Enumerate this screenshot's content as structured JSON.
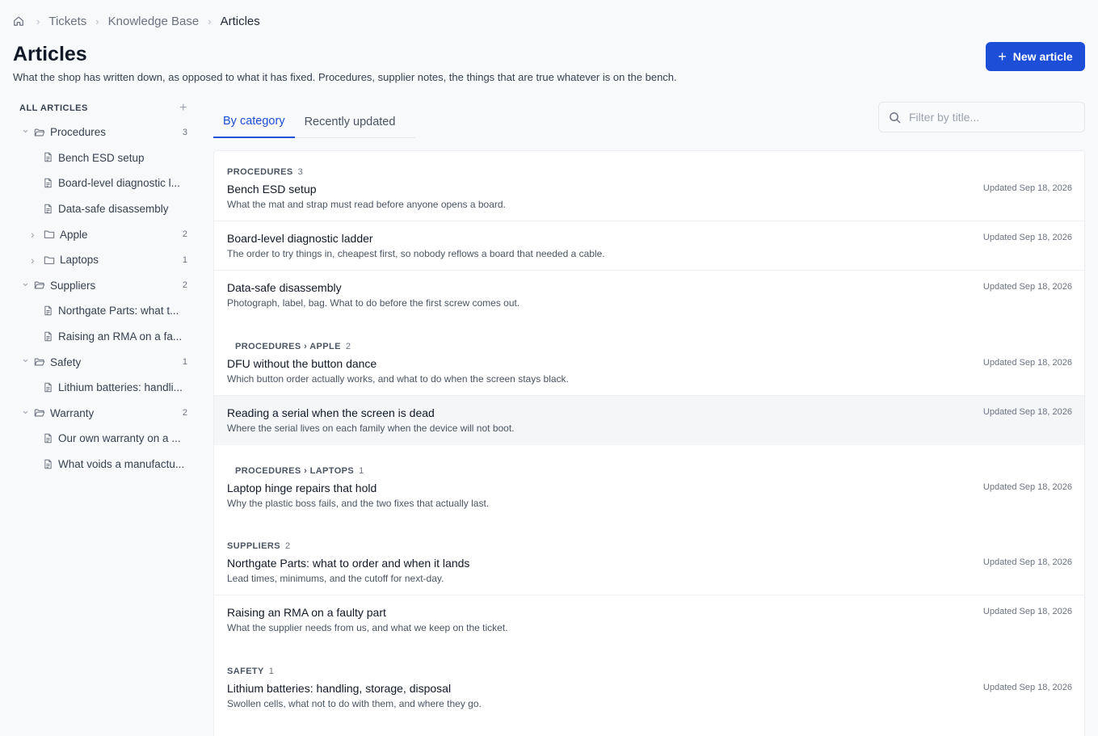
{
  "breadcrumb": {
    "items": [
      "Tickets",
      "Knowledge Base",
      "Articles"
    ]
  },
  "page": {
    "title": "Articles",
    "subtitle": "What the shop has written down, as opposed to what it has fixed. Procedures, supplier notes, the things that are true whatever is on the bench.",
    "new_button": "New article"
  },
  "sidebar": {
    "header": "ALL ARTICLES",
    "tree": [
      {
        "type": "folder",
        "label": "Procedures",
        "count": "3",
        "expanded": true
      },
      {
        "type": "doc",
        "label": "Bench ESD setup"
      },
      {
        "type": "doc",
        "label": "Board-level diagnostic l..."
      },
      {
        "type": "doc",
        "label": "Data-safe disassembly"
      },
      {
        "type": "subfolder",
        "label": "Apple",
        "count": "2"
      },
      {
        "type": "subfolder",
        "label": "Laptops",
        "count": "1"
      },
      {
        "type": "folder",
        "label": "Suppliers",
        "count": "2",
        "expanded": true
      },
      {
        "type": "doc",
        "label": "Northgate Parts: what t..."
      },
      {
        "type": "doc",
        "label": "Raising an RMA on a fa..."
      },
      {
        "type": "folder",
        "label": "Safety",
        "count": "1",
        "expanded": true
      },
      {
        "type": "doc",
        "label": "Lithium batteries: handli..."
      },
      {
        "type": "folder",
        "label": "Warranty",
        "count": "2",
        "expanded": true
      },
      {
        "type": "doc",
        "label": "Our own warranty on a ..."
      },
      {
        "type": "doc",
        "label": "What voids a manufactu..."
      }
    ]
  },
  "tabs": [
    "By category",
    "Recently updated"
  ],
  "filter": {
    "placeholder": "Filter by title..."
  },
  "groups": [
    {
      "name": "PROCEDURES",
      "count": "3",
      "articles": [
        {
          "title": "Bench ESD setup",
          "desc": "What the mat and strap must read before anyone opens a board.",
          "updated": "Updated Sep 18, 2026"
        },
        {
          "title": "Board-level diagnostic ladder",
          "desc": "The order to try things in, cheapest first, so nobody reflows a board that needed a cable.",
          "updated": "Updated Sep 18, 2026"
        },
        {
          "title": "Data-safe disassembly",
          "desc": "Photograph, label, bag. What to do before the first screw comes out.",
          "updated": "Updated Sep 18, 2026"
        }
      ]
    },
    {
      "name": "PROCEDURES › APPLE",
      "count": "2",
      "articles": [
        {
          "title": "DFU without the button dance",
          "desc": "Which button order actually works, and what to do when the screen stays black.",
          "updated": "Updated Sep 18, 2026"
        },
        {
          "title": "Reading a serial when the screen is dead",
          "desc": "Where the serial lives on each family when the device will not boot.",
          "updated": "Updated Sep 18, 2026"
        }
      ]
    },
    {
      "name": "PROCEDURES › LAPTOPS",
      "count": "1",
      "articles": [
        {
          "title": "Laptop hinge repairs that hold",
          "desc": "Why the plastic boss fails, and the two fixes that actually last.",
          "updated": "Updated Sep 18, 2026"
        }
      ]
    },
    {
      "name": "SUPPLIERS",
      "count": "2",
      "articles": [
        {
          "title": "Northgate Parts: what to order and when it lands",
          "desc": "Lead times, minimums, and the cutoff for next-day.",
          "updated": "Updated Sep 18, 2026"
        },
        {
          "title": "Raising an RMA on a faulty part",
          "desc": "What the supplier needs from us, and what we keep on the ticket.",
          "updated": "Updated Sep 18, 2026"
        }
      ]
    },
    {
      "name": "SAFETY",
      "count": "1",
      "articles": [
        {
          "title": "Lithium batteries: handling, storage, disposal",
          "desc": "Swollen cells, what not to do with them, and where they go.",
          "updated": "Updated Sep 18, 2026"
        }
      ]
    }
  ],
  "colors": {
    "accent": "#1d4ed8",
    "panel": "#ffffff",
    "background": "#f8f9fb"
  }
}
